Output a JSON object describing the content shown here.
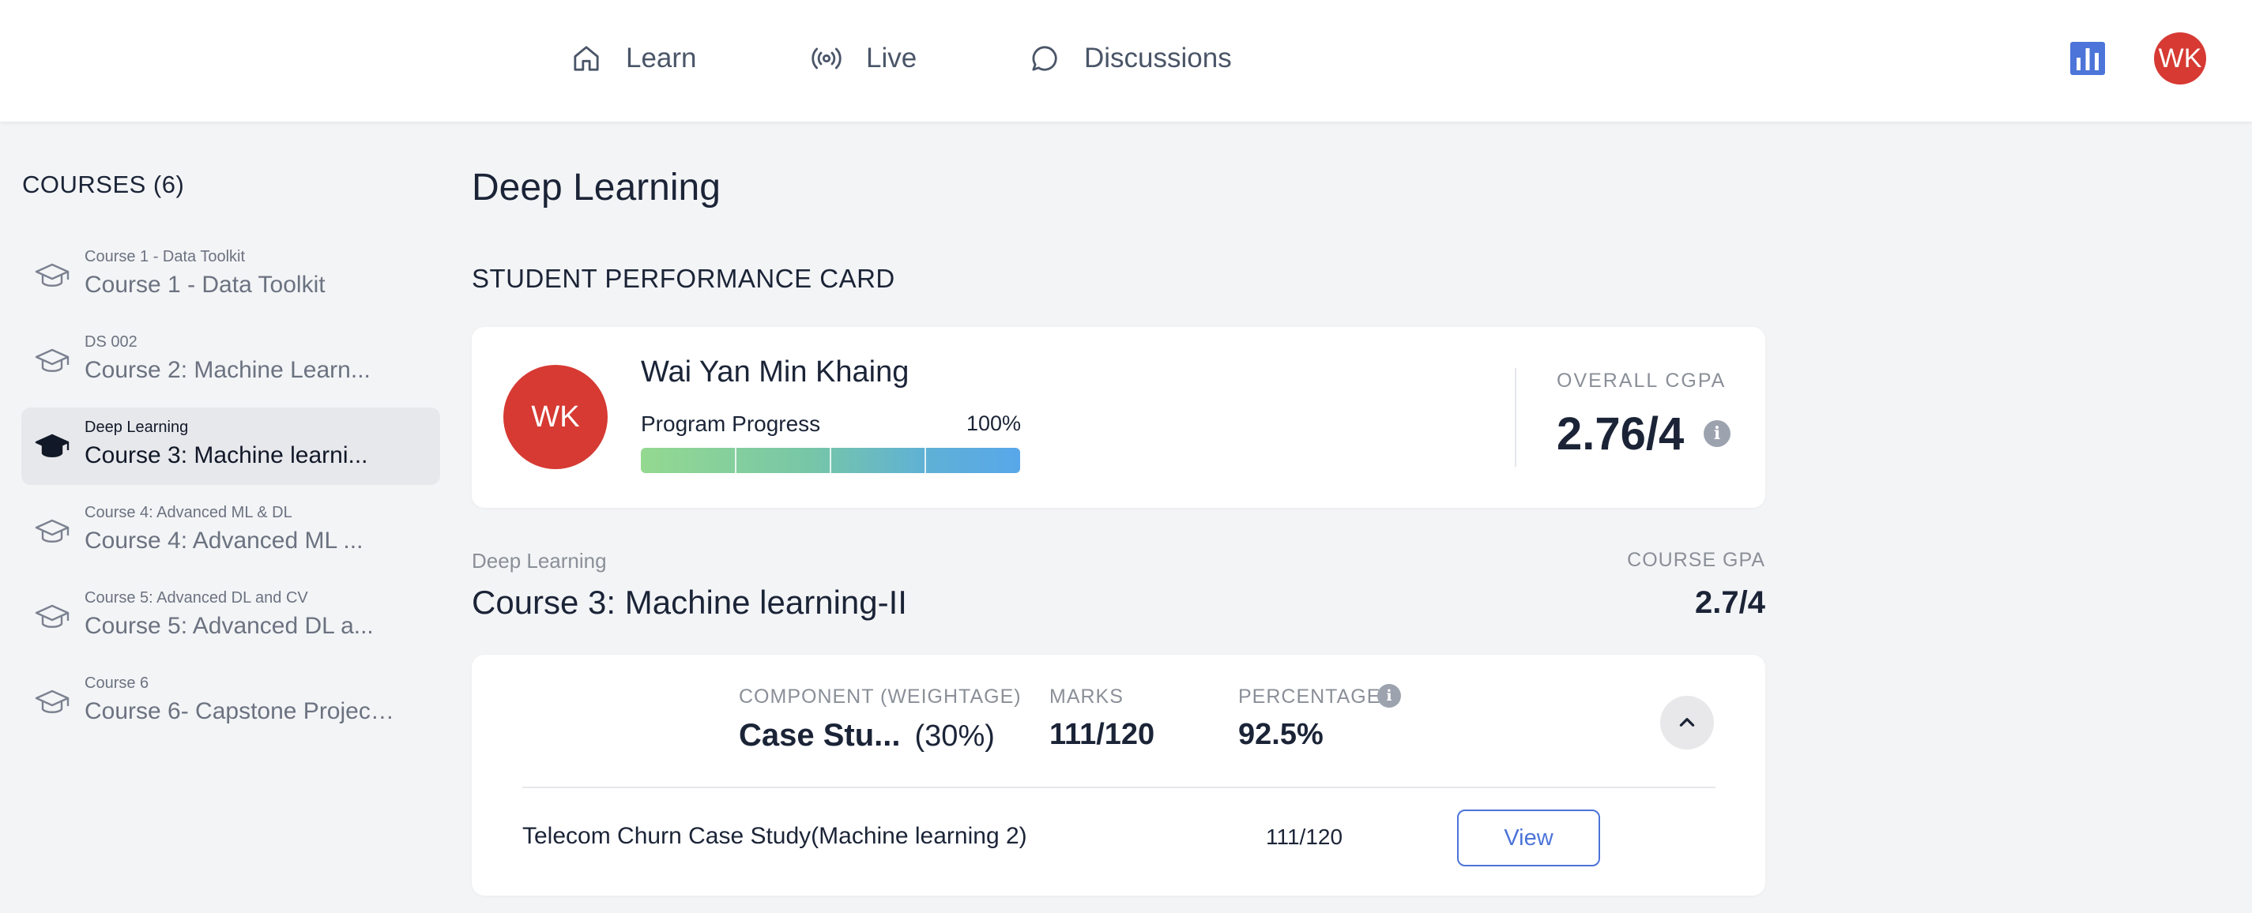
{
  "nav": {
    "items": [
      {
        "label": "Learn",
        "icon": "home-icon"
      },
      {
        "label": "Live",
        "icon": "broadcast-icon"
      },
      {
        "label": "Discussions",
        "icon": "chat-bubble-icon"
      }
    ],
    "stats_icon": "bar-chart-icon",
    "user_initials": "WK"
  },
  "sidebar": {
    "heading": "COURSES (6)",
    "courses": [
      {
        "subtitle": "Course 1 - Data Toolkit",
        "title": "Course 1 - Data Toolkit",
        "active": false
      },
      {
        "subtitle": "DS 002",
        "title": "Course 2: Machine Learn...",
        "active": false
      },
      {
        "subtitle": "Deep Learning",
        "title": "Course 3: Machine learni...",
        "active": true
      },
      {
        "subtitle": "Course 4: Advanced ML & DL",
        "title": "Course 4: Advanced ML ...",
        "active": false
      },
      {
        "subtitle": "Course 5: Advanced DL and CV",
        "title": "Course 5: Advanced DL a...",
        "active": false
      },
      {
        "subtitle": "Course 6",
        "title": "Course 6- Capstone Project ...",
        "active": false
      }
    ]
  },
  "main": {
    "page_title": "Deep Learning",
    "section_title": "STUDENT PERFORMANCE CARD",
    "student": {
      "initials": "WK",
      "name": "Wai Yan Min Khaing",
      "progress_label": "Program Progress",
      "progress_text": "100%",
      "progress_fraction": 1.0,
      "cgpa_label": "OVERALL CGPA",
      "cgpa_value": "2.76/4"
    },
    "course": {
      "breadcrumb": "Deep Learning",
      "title": "Course 3: Machine learning-II",
      "gpa_label": "COURSE GPA",
      "gpa_value": "2.7/4"
    },
    "component": {
      "headers": {
        "component": "COMPONENT (WEIGHTAGE)",
        "marks": "MARKS",
        "percentage": "PERCENTAGE"
      },
      "name": "Case Stu...",
      "weightage": "(30%)",
      "marks": "111/120",
      "percentage": "92.5%",
      "items": [
        {
          "name": "Telecom Churn Case Study(Machine learning 2)",
          "marks": "111/120",
          "action": "View"
        }
      ]
    }
  },
  "colors": {
    "accent": "#4c74d9",
    "avatar": "#d63a33",
    "progress_start": "#94d990",
    "progress_end": "#58a7ea"
  }
}
